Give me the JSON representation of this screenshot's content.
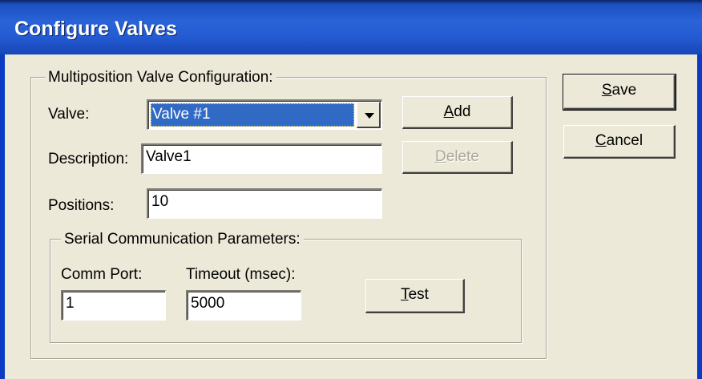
{
  "window": {
    "title": "Configure Valves"
  },
  "valve_group": {
    "title": "Multiposition Valve Configuration:"
  },
  "valve": {
    "label": "Valve:",
    "selected": "Valve #1"
  },
  "description": {
    "label": "Description:",
    "value": "Valve1"
  },
  "positions": {
    "label": "Positions:",
    "value": "10"
  },
  "buttons": {
    "add": {
      "access_key": "A",
      "rest": "dd"
    },
    "delete": {
      "access_key": "D",
      "rest": "elete"
    },
    "save": {
      "access_key": "S",
      "rest": "ave"
    },
    "cancel": {
      "access_key": "C",
      "rest": "ancel"
    },
    "test": {
      "access_key": "T",
      "rest": "est"
    }
  },
  "serial_group": {
    "title": "Serial Communication Parameters:"
  },
  "comm_port": {
    "label": "Comm Port:",
    "value": "1"
  },
  "timeout": {
    "label": "Timeout (msec):",
    "value": "5000"
  }
}
